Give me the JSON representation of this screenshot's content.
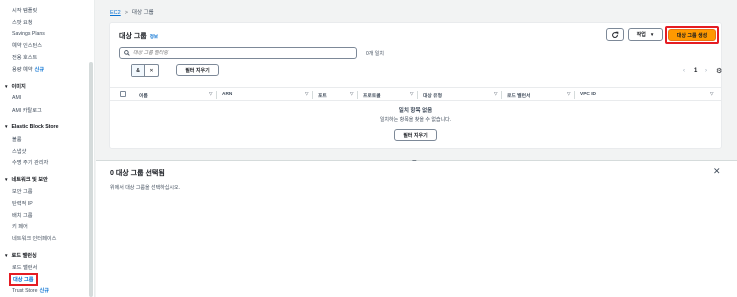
{
  "sidebar": {
    "items_top": [
      {
        "label": "시작 템플릿"
      },
      {
        "label": "스팟 요청"
      },
      {
        "label": "Savings Plans"
      },
      {
        "label": "예약 인스턴스"
      },
      {
        "label": "전용 호스트"
      },
      {
        "label": "용량 예약",
        "badge": "신규"
      }
    ],
    "sections": [
      {
        "title": "이미지",
        "items": [
          "AMI",
          "AMI 카탈로그"
        ]
      },
      {
        "title": "Elastic Block Store",
        "items": [
          "볼륨",
          "스냅샷",
          "수명 주기 관리자"
        ]
      },
      {
        "title": "네트워크 및 보안",
        "items": [
          "보안 그룹",
          "탄력적 IP",
          "배치 그룹",
          "키 페어",
          "네트워크 인터페이스"
        ]
      },
      {
        "title": "로드 밸런싱",
        "items": [
          "로드 밸런서",
          "대상 그룹",
          "Trust Store"
        ]
      }
    ],
    "trust_store_badge": "신규"
  },
  "breadcrumb": {
    "root": "EC2",
    "current": "대상 그룹"
  },
  "panel": {
    "title": "대상 그룹",
    "info": "정보",
    "refresh_icon": "refresh-icon",
    "actions_label": "작업",
    "create_label": "대상 그룹 생성",
    "search_placeholder": "대상 그룹 필터링",
    "match_count": "0개 일치",
    "token_label": "&",
    "clear_filters_label": "필터 지우기",
    "page_number": "1",
    "columns": [
      "이름",
      "ARN",
      "포트",
      "프로토콜",
      "대상 유형",
      "로드 밸런서",
      "VPC ID"
    ],
    "empty_title": "일치 항목 없음",
    "empty_sub": "일치하는 항목을 찾을 수 없습니다.",
    "empty_clear_label": "필터 지우기"
  },
  "detail": {
    "title": "0 대상 그룹 선택됨",
    "subtitle": "위에서 대상 그룹을 선택하십시오."
  },
  "colors": {
    "accent": "#ff9900",
    "link": "#0972d3",
    "highlight": "#e51c23"
  }
}
